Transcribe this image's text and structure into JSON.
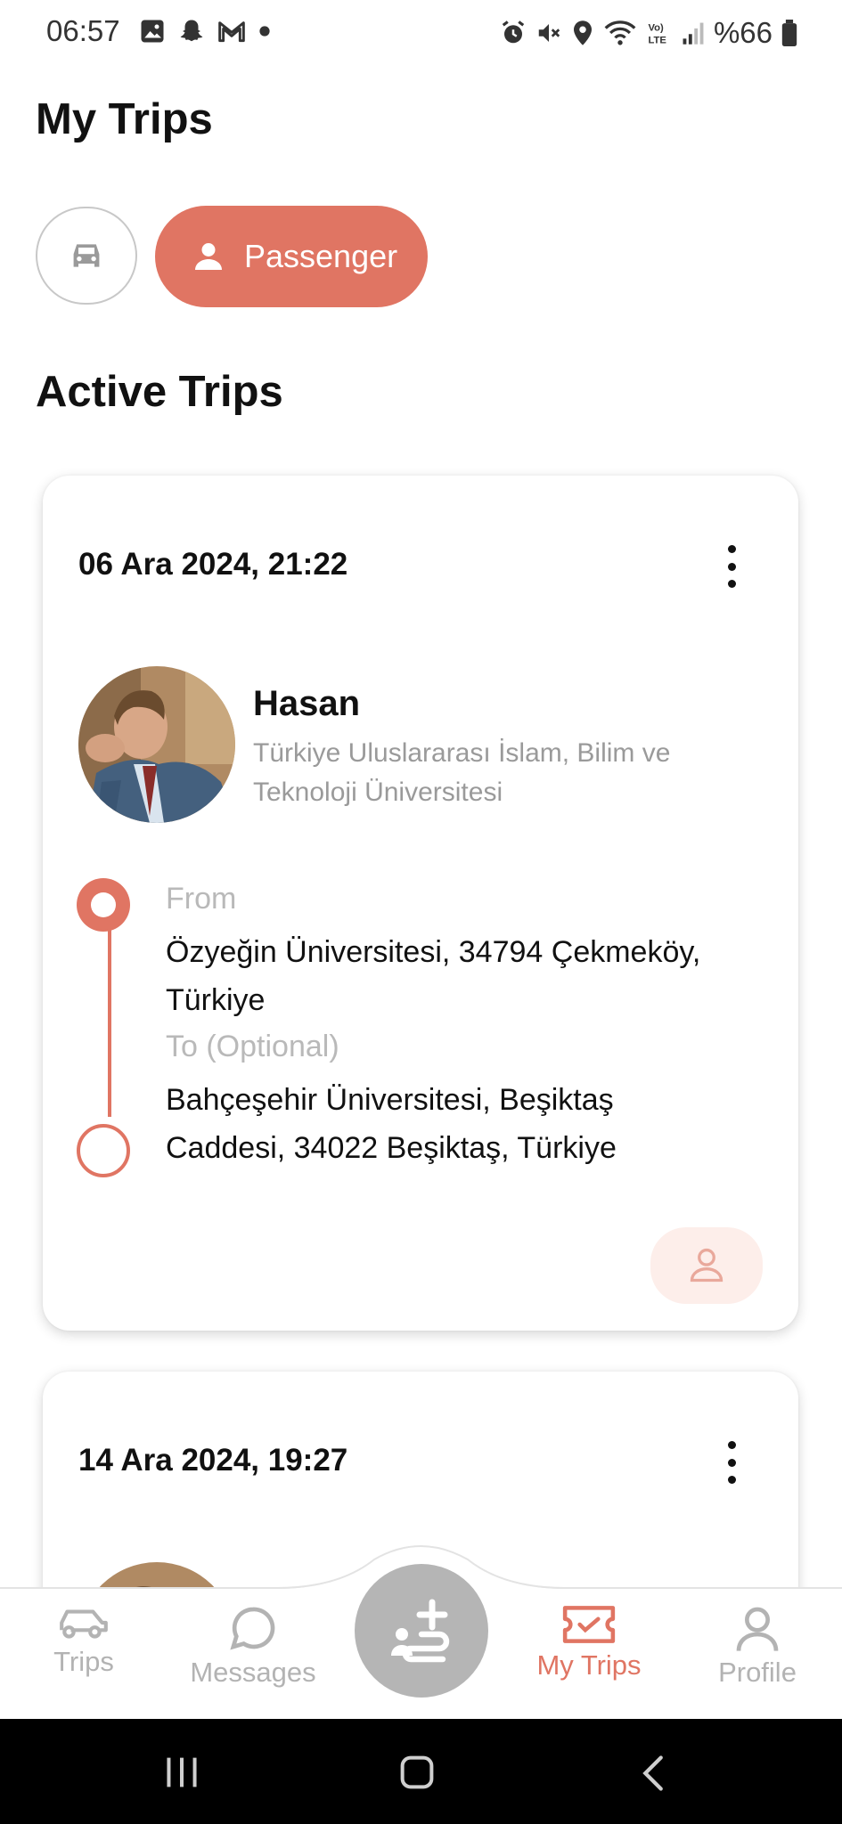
{
  "status_bar": {
    "time": "06:57",
    "battery": "%66"
  },
  "header": {
    "title": "My Trips"
  },
  "role_toggle": {
    "passenger_label": "Passenger"
  },
  "section": {
    "title": "Active Trips"
  },
  "trips": [
    {
      "date": "06 Ara 2024, 21:22",
      "driver_name": "Hasan",
      "driver_university": "Türkiye Uluslararası İslam, Bilim ve Teknoloji Üniversitesi",
      "from_label": "From",
      "from_address": "Özyeğin Üniversitesi, 34794 Çekmeköy, Türkiye",
      "to_label": "To (Optional)",
      "to_address": "Bahçeşehir Üniversitesi, Beşiktaş Caddesi, 34022 Beşiktaş, Türkiye"
    },
    {
      "date": "14 Ara 2024, 19:27"
    }
  ],
  "bottom_nav": {
    "trips": "Trips",
    "messages": "Messages",
    "my_trips": "My Trips",
    "profile": "Profile",
    "active": "my_trips"
  },
  "colors": {
    "accent": "#e07563",
    "inactive": "#b3b3b3"
  }
}
